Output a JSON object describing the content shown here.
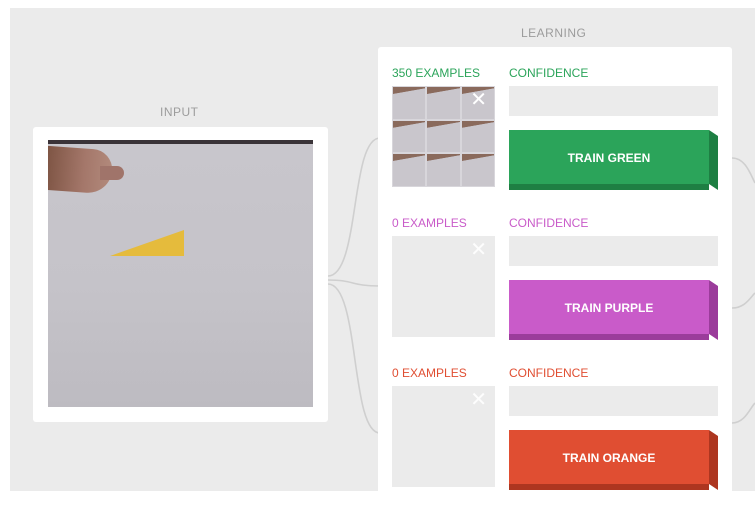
{
  "sections": {
    "input_label": "INPUT",
    "learning_label": "LEARNING"
  },
  "classes": [
    {
      "examples": "350 EXAMPLES",
      "confidence": "CONFIDENCE",
      "button": "TRAIN GREEN",
      "color": "#2ba45a",
      "dark": "#1e7f43",
      "close": "✕"
    },
    {
      "examples": "0 EXAMPLES",
      "confidence": "CONFIDENCE",
      "button": "TRAIN PURPLE",
      "color": "#c95bc9",
      "dark": "#9b3c9b",
      "close": "✕"
    },
    {
      "examples": "0 EXAMPLES",
      "confidence": "CONFIDENCE",
      "button": "TRAIN ORANGE",
      "color": "#e04e32",
      "dark": "#ad3620",
      "close": "✕"
    }
  ],
  "icons": {
    "close": "close-icon"
  }
}
